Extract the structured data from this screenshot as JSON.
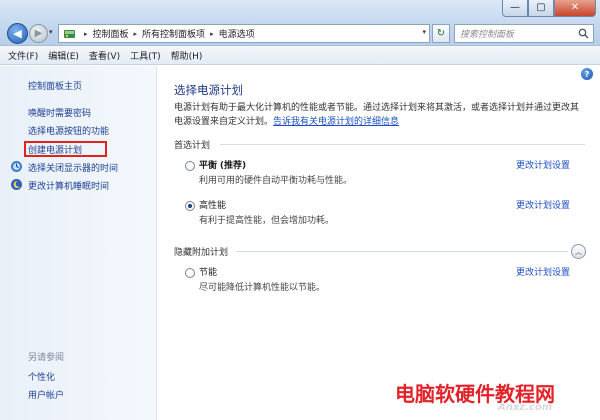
{
  "window": {
    "controls": {
      "minimize": "—",
      "maximize": "▢",
      "close": "✕"
    }
  },
  "nav": {
    "back": "◀",
    "forward": "▶",
    "dropdown": "▾",
    "refresh": "↻"
  },
  "address": {
    "crumbs": [
      "控制面板",
      "所有控制面板项",
      "电源选项"
    ],
    "separator": "▸"
  },
  "search": {
    "placeholder": "搜索控制面板"
  },
  "menubar": {
    "items": [
      "文件(F)",
      "编辑(E)",
      "查看(V)",
      "工具(T)",
      "帮助(H)"
    ]
  },
  "sidebar": {
    "home": "控制面板主页",
    "links": [
      "唤醒时需要密码",
      "选择电源按钮的功能",
      "创建电源计划"
    ],
    "icon_links": [
      "选择关闭显示器的时间",
      "更改计算机睡眠时间"
    ],
    "see_also_header": "另请参阅",
    "see_also": [
      "个性化",
      "用户帐户"
    ]
  },
  "main": {
    "title": "选择电源计划",
    "description": "电源计划有助于最大化计算机的性能或者节能。通过选择计划来将其激活，或者选择计划并通过更改其电源设置来自定义计划。",
    "description_link": "告诉我有关电源计划的详细信息",
    "preferred_label": "首选计划",
    "hidden_label": "隐藏附加计划",
    "change_settings": "更改计划设置",
    "plans": [
      {
        "name": "平衡",
        "tag": "(推荐)",
        "desc": "利用可用的硬件自动平衡功耗与性能。",
        "selected": false
      },
      {
        "name": "高性能",
        "tag": "",
        "desc": "有利于提高性能，但会增加功耗。",
        "selected": true
      },
      {
        "name": "节能",
        "tag": "",
        "desc": "尽可能降低计算机性能以节能。",
        "selected": false
      }
    ],
    "collapse": "︿"
  },
  "watermark": {
    "text": "电脑软硬件教程网",
    "sub": "Anxz.com"
  },
  "colors": {
    "link": "#1c4fc2",
    "title": "#1e3a8a",
    "highlight": "#e0241b",
    "watermark": "#e3232a"
  }
}
